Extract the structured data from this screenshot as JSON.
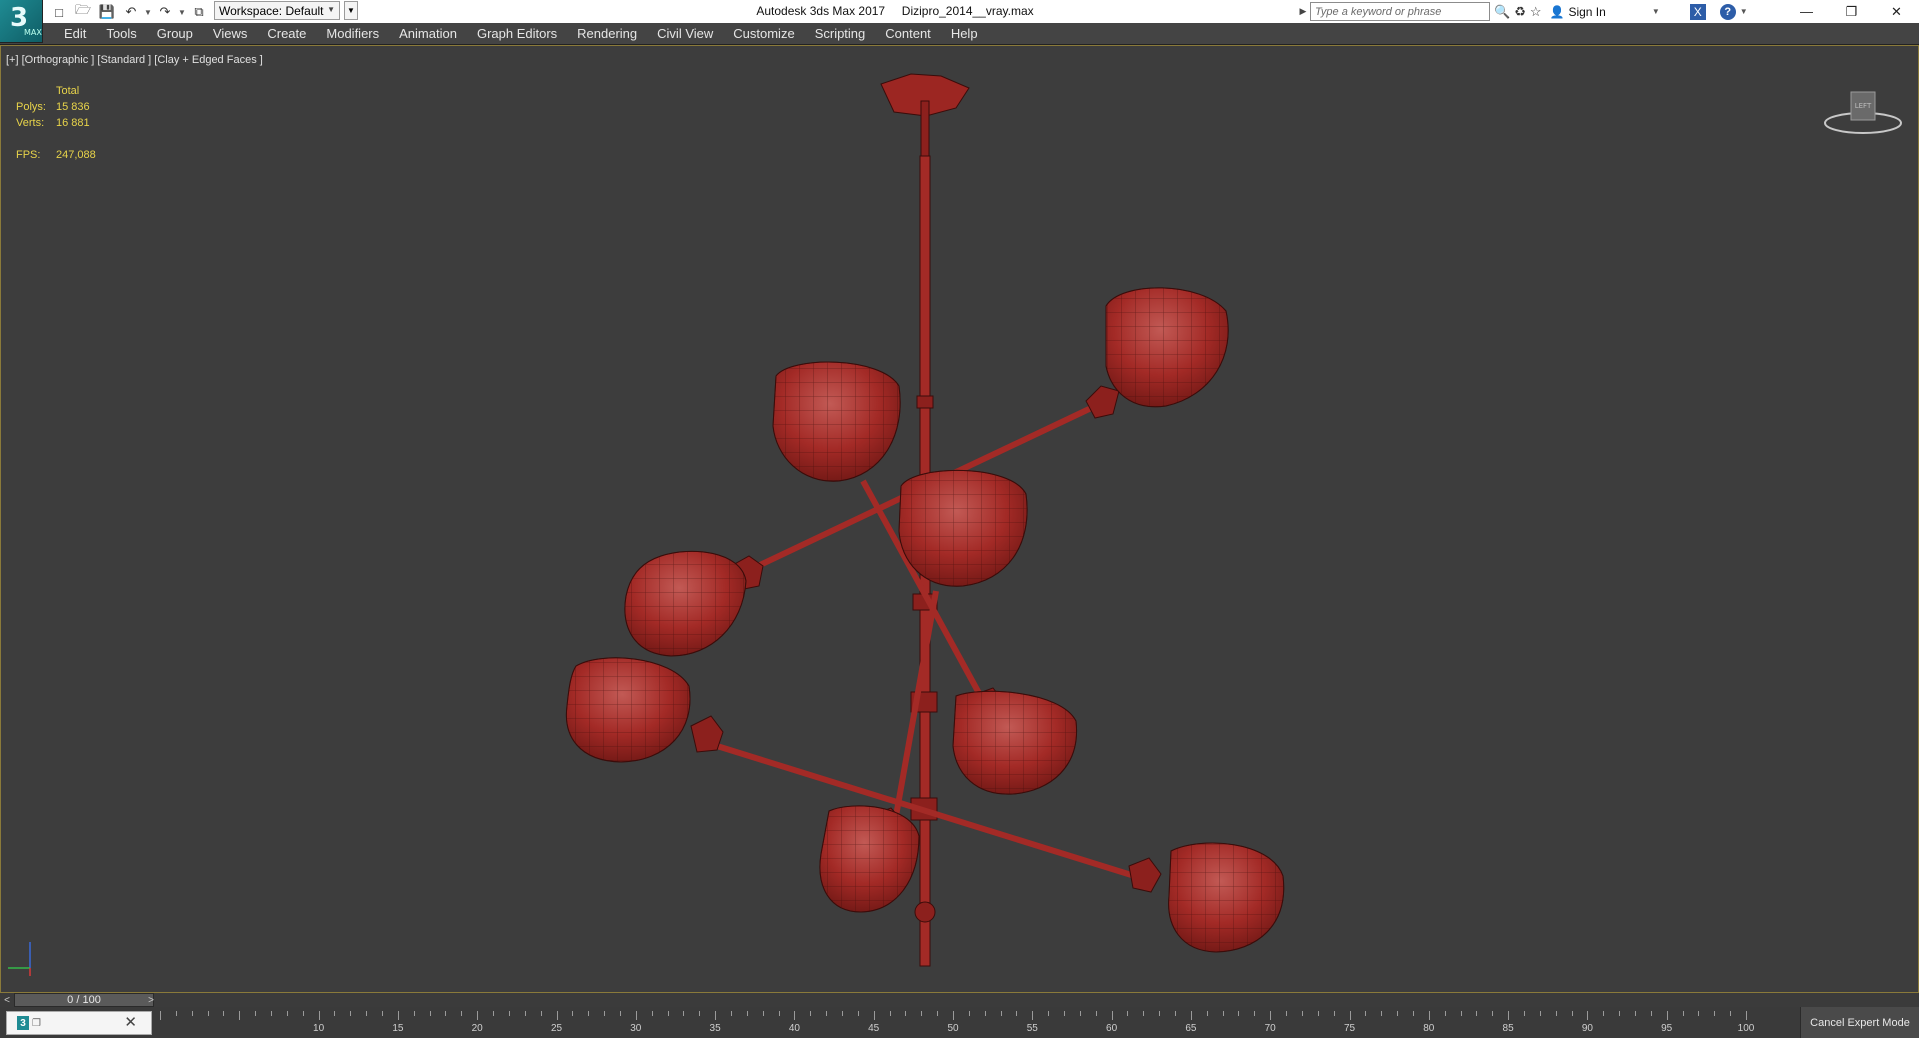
{
  "window": {
    "title": "Autodesk 3ds Max 2017     Dizipro_2014__vray.max",
    "logo": "3",
    "logo_sub": "MAX"
  },
  "toolbar": {
    "workspace_label": "Workspace: Default",
    "icons": [
      "new-file-icon",
      "open-file-icon",
      "save-icon",
      "undo-icon",
      "redo-icon",
      "project-folder-icon"
    ]
  },
  "search": {
    "placeholder": "Type a keyword or phrase"
  },
  "account": {
    "sign_in": "Sign In",
    "help": "?",
    "exchange": "X"
  },
  "menu": {
    "items": [
      "Edit",
      "Tools",
      "Group",
      "Views",
      "Create",
      "Modifiers",
      "Animation",
      "Graph Editors",
      "Rendering",
      "Civil View",
      "Customize",
      "Scripting",
      "Content",
      "Help"
    ]
  },
  "viewport": {
    "label": "[+] [Orthographic ] [Standard ] [Clay + Edged Faces ]",
    "stats": {
      "total_label": "Total",
      "polys_label": "Polys:",
      "polys_value": "15 836",
      "verts_label": "Verts:",
      "verts_value": "16 881",
      "fps_label": "FPS:",
      "fps_value": "247,088"
    },
    "viewcube_label": "LEFT",
    "model_color": "#a32a26"
  },
  "timeline": {
    "frame_display": "0 / 100",
    "prev": "<",
    "next": ">",
    "ruler_labels": [
      "10",
      "15",
      "20",
      "25",
      "30",
      "35",
      "40",
      "45",
      "50",
      "55",
      "60",
      "65",
      "70",
      "75",
      "80",
      "85",
      "90",
      "95",
      "100"
    ]
  },
  "bottom": {
    "expert_button": "Cancel Expert Mode"
  }
}
